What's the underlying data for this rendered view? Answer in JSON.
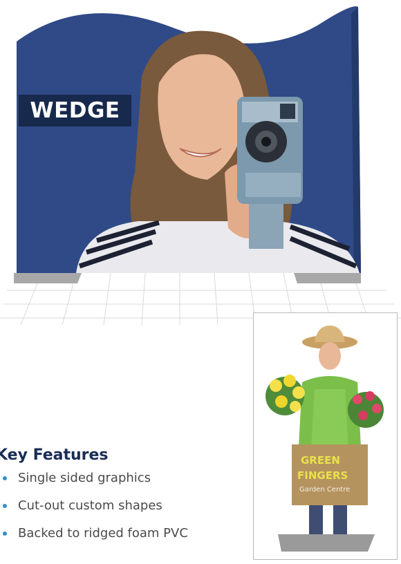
{
  "hero": {
    "label": "WEDGE",
    "colors": {
      "panel": "#2f4a86",
      "label_bg": "#17294d"
    }
  },
  "promo": {
    "sign_lines": [
      "GREEN",
      "FINGERS",
      "Garden Centre"
    ]
  },
  "features": {
    "title": "Key Features",
    "items": [
      "Single sided graphics",
      "Cut-out custom shapes",
      "Backed to ridged foam PVC"
    ],
    "colors": {
      "title": "#1a2c55",
      "bullet": "#2e8fd0",
      "text": "#4a4a4a"
    }
  }
}
